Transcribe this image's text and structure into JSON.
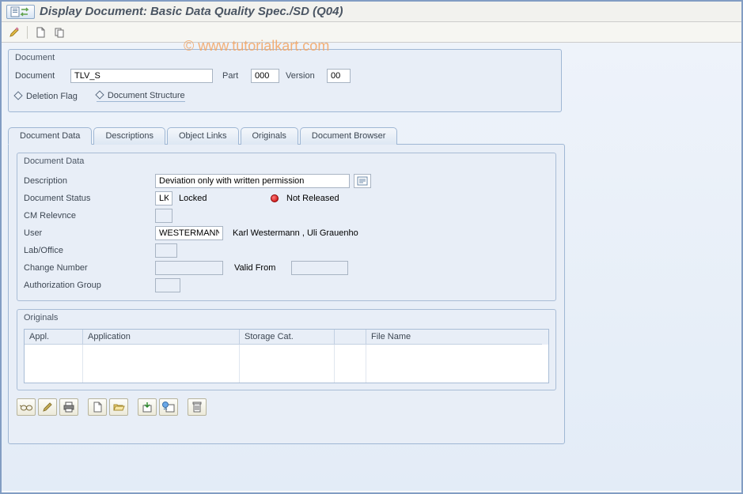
{
  "title": "Display Document: Basic Data Quality Spec./SD (Q04)",
  "watermark": "© www.tutorialkart.com",
  "header_group": {
    "title": "Document",
    "fields": {
      "document_label": "Document",
      "document": "TLV_S",
      "part_label": "Part",
      "part": "000",
      "version_label": "Version",
      "version": "00",
      "deletion_flag": "Deletion Flag",
      "doc_structure": "Document Structure"
    }
  },
  "tabs": [
    {
      "id": "doc_data",
      "label": "Document Data",
      "active": true
    },
    {
      "id": "descriptions",
      "label": "Descriptions",
      "active": false
    },
    {
      "id": "object_links",
      "label": "Object Links",
      "active": false
    },
    {
      "id": "originals",
      "label": "Originals",
      "active": false
    },
    {
      "id": "doc_browser",
      "label": "Document Browser",
      "active": false
    }
  ],
  "doc_data_group": {
    "title": "Document Data",
    "description_label": "Description",
    "description": "Deviation only with written permission",
    "status_label": "Document Status",
    "status_code": "LK",
    "status_text": "Locked",
    "status_release": "Not Released",
    "cm_label": "CM Relevnce",
    "cm": "",
    "user_label": "User",
    "user": "WESTERMANN",
    "user_full": "Karl Westermann , Uli Grauenho",
    "lab_label": "Lab/Office",
    "lab": "",
    "change_label": "Change Number",
    "change": "",
    "valid_from_label": "Valid From",
    "valid_from": "",
    "auth_label": "Authorization Group",
    "auth": ""
  },
  "originals_group": {
    "title": "Originals",
    "columns": {
      "appl_short": "Appl.",
      "application": "Application",
      "storage_cat": "Storage Cat.",
      "blank": "",
      "file_name": "File Name"
    }
  },
  "icon_names": {
    "pencil": "pencil-icon",
    "doc": "document-icon",
    "copy": "copy-icon",
    "glasses": "display-icon",
    "print": "print-icon",
    "new": "new-icon",
    "open": "open-icon",
    "checkin": "checkin-icon",
    "checkout": "checkout-icon",
    "delete": "delete-icon"
  }
}
